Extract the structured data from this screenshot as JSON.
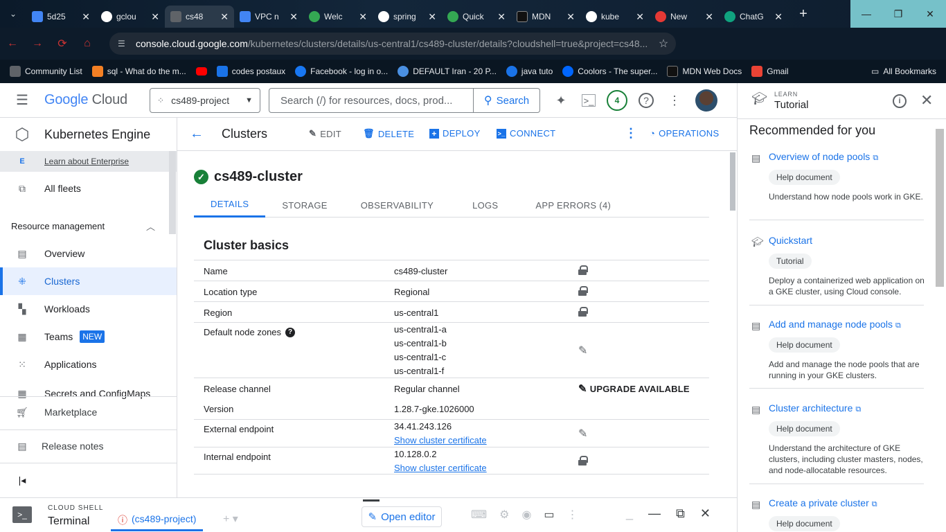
{
  "browser": {
    "tabs": [
      {
        "title": "5d25",
        "color": "#4285f4"
      },
      {
        "title": "gclou",
        "color": "#ffffff"
      },
      {
        "title": "cs48",
        "color": "#5f6368"
      },
      {
        "title": "VPC n",
        "color": "#4285f4"
      },
      {
        "title": "Welc",
        "color": "#34a853"
      },
      {
        "title": "spring",
        "color": "#ffffff"
      },
      {
        "title": "Quick",
        "color": "#34a853"
      },
      {
        "title": "MDN",
        "color": "#111111"
      },
      {
        "title": "kube",
        "color": "#ffffff"
      },
      {
        "title": "New",
        "color": "#e53935"
      },
      {
        "title": "ChatG",
        "color": "#10a37f"
      }
    ],
    "url_host": "console.cloud.google.com",
    "url_path": "/kubernetes/clusters/details/us-central1/cs489-cluster/details?cloudshell=true&project=cs48...",
    "bookmarks": [
      {
        "label": "Community List",
        "color": "#5f6368"
      },
      {
        "label": "sql - What do the m...",
        "color": "#f48024"
      },
      {
        "label": "",
        "color": "#ff0000"
      },
      {
        "label": "codes postaux",
        "color": "#1a73e8"
      },
      {
        "label": "Facebook - log in o...",
        "color": "#1877f2"
      },
      {
        "label": "DEFAULT Iran - 20 P...",
        "color": "#4a90e2"
      },
      {
        "label": "java tuto",
        "color": "#1a73e8"
      },
      {
        "label": "Coolors - The super...",
        "color": "#0066ff"
      },
      {
        "label": "MDN Web Docs",
        "color": "#111111"
      },
      {
        "label": "Gmail",
        "color": "#ea4335"
      }
    ],
    "all_bookmarks": "All Bookmarks"
  },
  "header": {
    "logo_google": "Google",
    "logo_cloud": "Cloud",
    "project": "cs489-project",
    "search_placeholder": "Search (/) for resources, docs, prod...",
    "search_button": "Search",
    "notifications_count": "4"
  },
  "leftnav": {
    "product": "Kubernetes Engine",
    "enterprise_link": "Learn about Enterprise",
    "all_fleets": "All fleets",
    "section": "Resource management",
    "items": [
      {
        "label": "Overview"
      },
      {
        "label": "Clusters"
      },
      {
        "label": "Workloads"
      },
      {
        "label": "Teams",
        "badge": "NEW"
      },
      {
        "label": "Applications"
      },
      {
        "label": "Secrets and ConfigMaps"
      }
    ],
    "marketplace": "Marketplace",
    "release_notes": "Release notes"
  },
  "page": {
    "title": "Clusters",
    "actions": {
      "edit": "EDIT",
      "delete": "DELETE",
      "deploy": "DEPLOY",
      "connect": "CONNECT",
      "operations": "OPERATIONS"
    },
    "cluster_name": "cs489-cluster",
    "tabs": [
      "DETAILS",
      "STORAGE",
      "OBSERVABILITY",
      "LOGS",
      "APP ERRORS (4)"
    ],
    "section_title": "Cluster basics",
    "rows": [
      {
        "key": "Name",
        "value": "cs489-cluster"
      },
      {
        "key": "Location type",
        "value": "Regional"
      },
      {
        "key": "Region",
        "value": "us-central1"
      },
      {
        "key": "Default node zones",
        "values": [
          "us-central1-a",
          "us-central1-b",
          "us-central1-c",
          "us-central1-f"
        ]
      },
      {
        "key": "Release channel",
        "value": "Regular channel",
        "action": "UPGRADE AVAILABLE"
      },
      {
        "key": "Version",
        "value": "1.28.7-gke.1026000"
      },
      {
        "key": "External endpoint",
        "value": "34.41.243.126",
        "link": "Show cluster certificate"
      },
      {
        "key": "Internal endpoint",
        "value": "10.128.0.2",
        "link": "Show cluster certificate"
      }
    ]
  },
  "cloudshell": {
    "label": "CLOUD SHELL",
    "terminal": "Terminal",
    "tab": "(cs489-project)",
    "open_editor": "Open editor"
  },
  "tutorial": {
    "learn": "LEARN",
    "title": "Tutorial",
    "recommended": "Recommended for you",
    "cards": [
      {
        "title": "Overview of node pools",
        "chip": "Help document",
        "desc": "Understand how node pools work in GKE."
      },
      {
        "title": "Quickstart",
        "chip": "Tutorial",
        "desc": "Deploy a containerized web application on a GKE cluster, using Cloud console."
      },
      {
        "title": "Add and manage node pools",
        "chip": "Help document",
        "desc": "Add and manage the node pools that are running in your GKE clusters."
      },
      {
        "title": "Cluster architecture",
        "chip": "Help document",
        "desc": "Understand the architecture of GKE clusters, including cluster masters, nodes, and node-allocatable resources."
      },
      {
        "title": "Create a private cluster",
        "chip": "Help document",
        "desc": ""
      }
    ]
  }
}
